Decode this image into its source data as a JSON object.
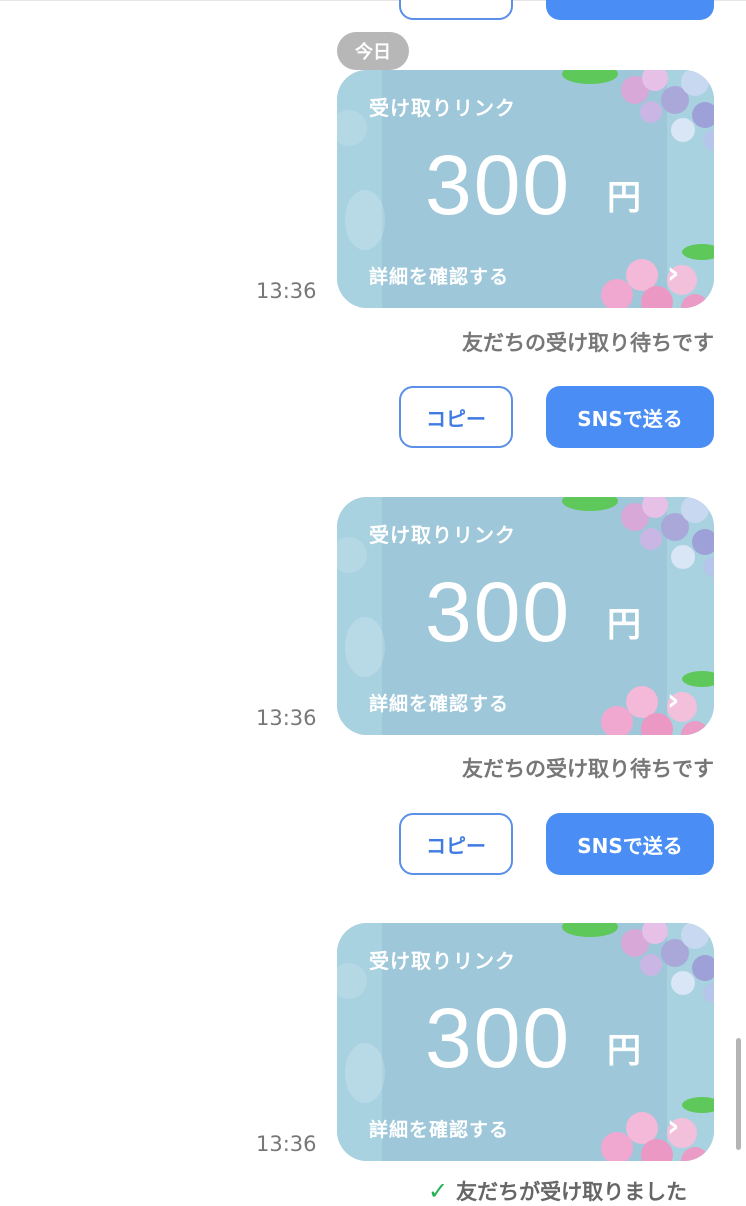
{
  "date_separator": "今日",
  "cards": [
    {
      "label": "受け取りリンク",
      "amount": "300",
      "currency": "円",
      "detail": "詳細を確認する",
      "time": "13:36",
      "status": "友だちの受け取り待ちです"
    },
    {
      "label": "受け取りリンク",
      "amount": "300",
      "currency": "円",
      "detail": "詳細を確認する",
      "time": "13:36",
      "status": "友だちの受け取り待ちです"
    },
    {
      "label": "受け取りリンク",
      "amount": "300",
      "currency": "円",
      "detail": "詳細を確認する",
      "time": "13:36",
      "status": "友だちが受け取りました"
    }
  ],
  "buttons": {
    "copy": "コピー",
    "sns": "SNSで送る"
  },
  "icons": {
    "chevron": "chevron-right-icon",
    "check": "checkmark-icon"
  },
  "colors": {
    "primary": "#4a8ef5",
    "card_bg": "#9ec7d9",
    "status_check": "#21b356"
  }
}
